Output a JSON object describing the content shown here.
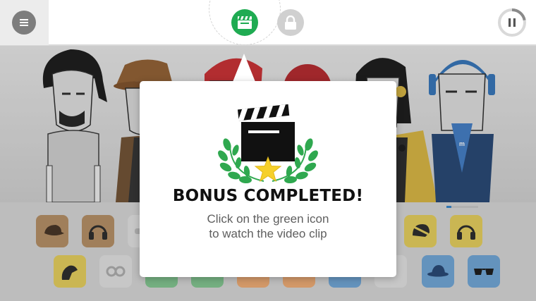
{
  "dialog": {
    "title": "BONUS COMPLETED!",
    "line1": "Click on the green icon",
    "line2": "to watch the video clip"
  },
  "topbar": {
    "menu_icon": "hamburger-icon",
    "tabs": [
      {
        "name": "video-clip",
        "icon": "clapperboard-icon",
        "state": "active",
        "color": "#1fab52"
      },
      {
        "name": "locked",
        "icon": "lock-icon",
        "state": "locked",
        "color": "#d0d0d0"
      }
    ],
    "pause_icon": "pause-icon",
    "loading_ring_progress": 0.22
  },
  "stage": {
    "characters": 6
  },
  "tray": {
    "row1": [
      "brown-hat",
      "headphones",
      "shades",
      "scooter-helmet",
      "yellow-headphones"
    ],
    "row2": [
      "yellow-wings",
      "goggles",
      "green",
      "green",
      "orange",
      "orange",
      "blue",
      "glasses-grey",
      "blue-fedora",
      "blue-sunglasses"
    ],
    "colors": {
      "brown": "#b38a5e",
      "yellow": "#e6ce55",
      "grey": "#e2e2e2",
      "green": "#7dc58c",
      "orange": "#f0a96e",
      "blue": "#6aa3d6"
    }
  }
}
